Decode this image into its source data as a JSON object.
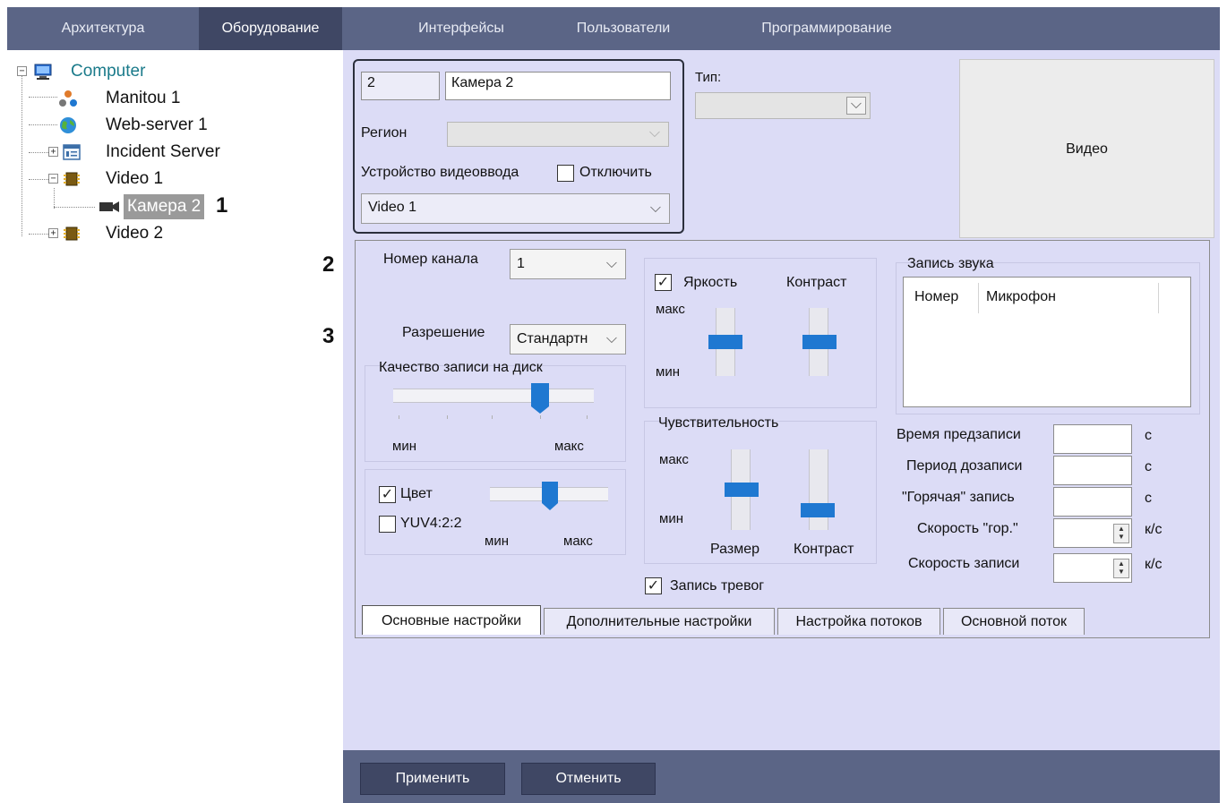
{
  "nav": {
    "tabs": [
      "Архитектура",
      "Оборудование",
      "Интерфейсы",
      "Пользователи",
      "Программирование"
    ],
    "active": "Оборудование"
  },
  "tree": {
    "items": [
      {
        "label": "Computer",
        "icon": "computer-icon",
        "expander": "−"
      },
      {
        "label": "Manitou 1",
        "icon": "manitou-icon"
      },
      {
        "label": "Web-server 1",
        "icon": "globe-icon"
      },
      {
        "label": "Incident Server",
        "icon": "incident-server-icon",
        "expander": "+"
      },
      {
        "label": "Video 1",
        "icon": "chip-icon",
        "expander": "−"
      },
      {
        "label": "Камера 2",
        "icon": "camera-icon",
        "selected": true
      },
      {
        "label": "Video 2",
        "icon": "chip-icon",
        "expander": "+"
      }
    ]
  },
  "markers": [
    "1",
    "2",
    "3"
  ],
  "device": {
    "id": "2",
    "name": "Камера 2",
    "type_label": "Тип:",
    "type_value": "",
    "region_label": "Регион",
    "region_value": "",
    "capture_label": "Устройство видеоввода",
    "disable_label": "Отключить",
    "disable_checked": false,
    "capture_value": "Video 1",
    "video_button": "Видео"
  },
  "settings": {
    "channel_label": "Номер канала",
    "channel_value": "1",
    "resolution_label": "Разрешение",
    "resolution_value": "Стандартн",
    "quality_label": "Качество записи на диск",
    "quality_level": 0.73,
    "min": "мин",
    "max": "макс",
    "color_label": "Цвет",
    "color_checked": true,
    "yuv_label": "YUV4:2:2",
    "yuv_checked": false,
    "color_level": 0.51,
    "brightness_label": "Яркость",
    "brightness_checked": true,
    "contrast_label": "Контраст",
    "brightness_level": 0.5,
    "contrast_level": 0.5,
    "sensitivity_label": "Чувствительность",
    "size_label": "Размер",
    "size_level": 0.5,
    "sens_contrast_level": 0.25,
    "alarm_record_label": "Запись тревог",
    "alarm_record_checked": true,
    "audio_group_label": "Запись звука",
    "audio_columns": [
      "Номер",
      "Микрофон"
    ],
    "prerecord_label": "Время предзаписи",
    "postrecord_label": "Период дозаписи",
    "hot_record_label": "\"Горячая\" запись",
    "hot_speed_label": "Скорость \"гор.\"",
    "record_speed_label": "Скорость записи",
    "unit_s": "с",
    "unit_fps": "к/с"
  },
  "tabs": [
    "Основные настройки",
    "Дополнительные настройки",
    "Настройка потоков",
    "Основной поток"
  ],
  "active_tab": "Основные настройки",
  "buttons": {
    "apply": "Применить",
    "cancel": "Отменить"
  },
  "colors": {
    "nav_bg": "#5b6586",
    "nav_active": "#3f4764",
    "panel_bg": "#dcdcf6",
    "slider_thumb": "#1f78d1",
    "selection": "#9a9a9a",
    "tree_computer": "#1a7a8a"
  }
}
